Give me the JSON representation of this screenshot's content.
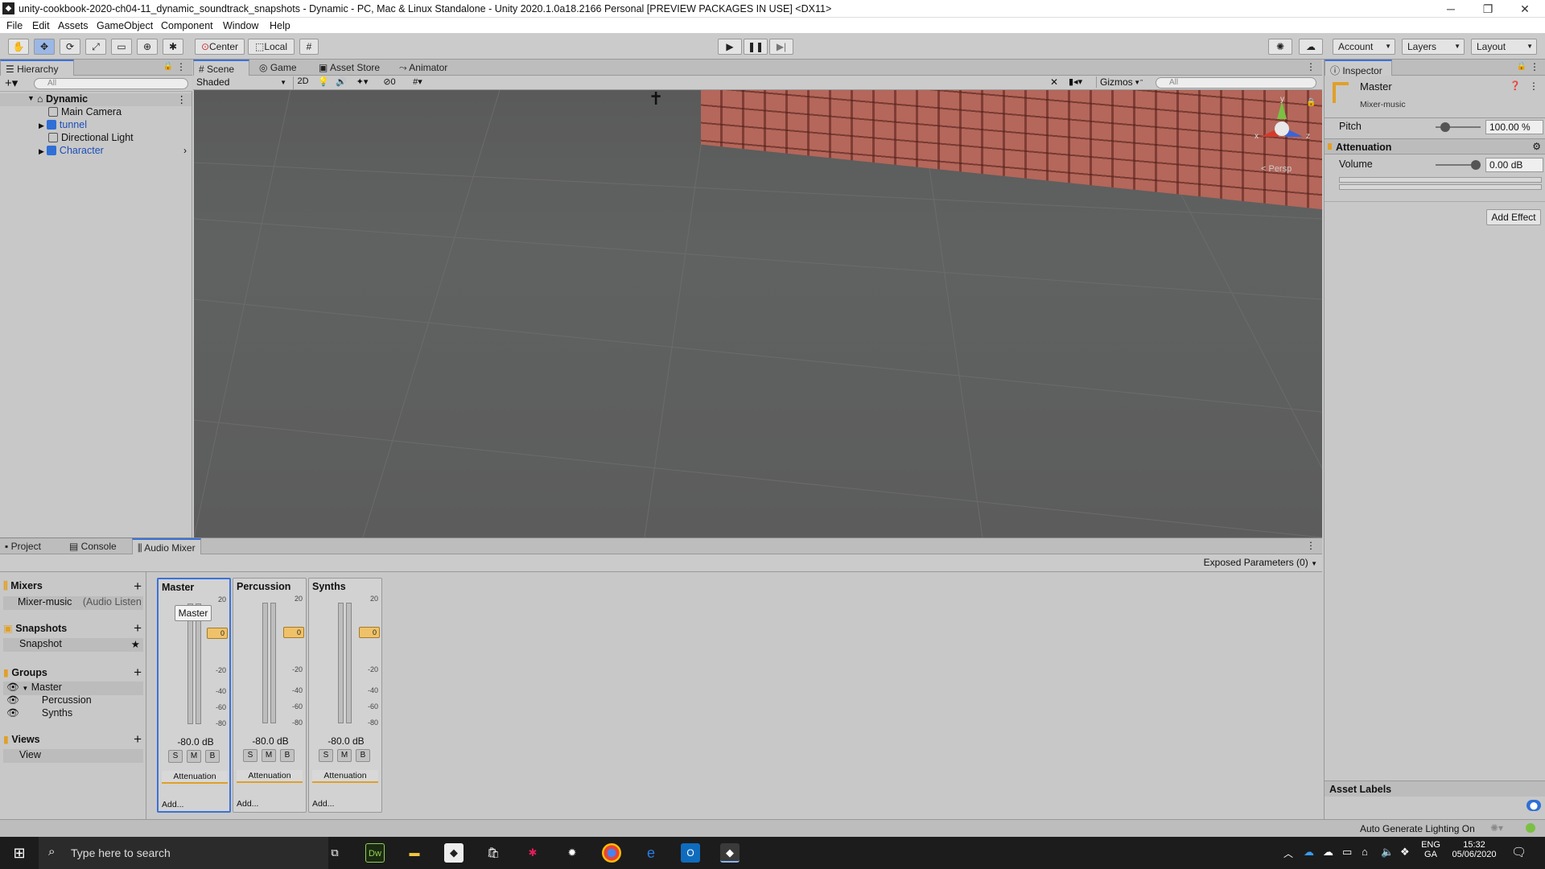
{
  "window": {
    "title": "unity-cookbook-2020-ch04-11_dynamic_soundtrack_snapshots - Dynamic - PC, Mac & Linux Standalone - Unity 2020.1.0a18.2166 Personal [PREVIEW PACKAGES IN USE] <DX11>",
    "app_icon": "unity-icon",
    "controls": [
      "─",
      "❐",
      "✕"
    ]
  },
  "menu": [
    "File",
    "Edit",
    "Assets",
    "GameObject",
    "Component",
    "Window",
    "Help"
  ],
  "toolbar": {
    "pivot": "Center",
    "space": "Local",
    "account": "Account",
    "layers": "Layers",
    "layout": "Layout"
  },
  "hierarchy": {
    "tab": "Hierarchy",
    "search_placeholder": "All",
    "scene": "Dynamic",
    "items": [
      {
        "label": "Main Camera"
      },
      {
        "label": "tunnel"
      },
      {
        "label": "Directional Light"
      },
      {
        "label": "Character"
      }
    ]
  },
  "scene_tabs": [
    "Scene",
    "Game",
    "Asset Store",
    "Animator"
  ],
  "scene_toolbar": {
    "shading": "Shaded",
    "mode2d": "2D",
    "hidden_count": "0",
    "gizmos": "Gizmos",
    "search_placeholder": "All",
    "persp_label": "< Persp"
  },
  "inspector": {
    "tab": "Inspector",
    "object_name": "Master",
    "subtitle": "Mixer-music",
    "pitch_label": "Pitch",
    "pitch_value": "100.00 %",
    "section": "Attenuation",
    "volume_label": "Volume",
    "volume_value": "0.00 dB",
    "add_effect": "Add Effect",
    "asset_labels": "Asset Labels",
    "status": "Auto Generate Lighting On"
  },
  "bottom_tabs": [
    "Project",
    "Console",
    "Audio Mixer"
  ],
  "audio_mixer": {
    "exposed_params": "Exposed Parameters (0)",
    "mixers_title": "Mixers",
    "mixer_item": "Mixer-music",
    "mixer_item_suffix": "(Audio Listen",
    "snapshots_title": "Snapshots",
    "snapshot_item": "Snapshot",
    "groups_title": "Groups",
    "groups": [
      "Master",
      "Percussion",
      "Synths"
    ],
    "views_title": "Views",
    "view_item": "View",
    "scale_labels": [
      "20",
      "0",
      "-20",
      "-40",
      "-60",
      "-80"
    ],
    "fader_value": "0",
    "tooltip": "Master",
    "channels": [
      {
        "name": "Master",
        "db": "-80.0 dB",
        "effect": "Attenuation",
        "add": "Add..."
      },
      {
        "name": "Percussion",
        "db": "-80.0 dB",
        "effect": "Attenuation",
        "add": "Add..."
      },
      {
        "name": "Synths",
        "db": "-80.0 dB",
        "effect": "Attenuation",
        "add": "Add..."
      }
    ],
    "buttons": [
      "S",
      "M",
      "B"
    ]
  },
  "taskbar": {
    "search_placeholder": "Type here to search",
    "lang_top": "ENG",
    "lang_bottom": "GA",
    "time": "15:32",
    "date": "05/06/2020",
    "dw_label": "Dw"
  },
  "colors": {
    "accent": "#3a72d8",
    "scene_bg": "#5c5c5c",
    "fader": "#efc26a",
    "effect_bar": "#e0a028"
  }
}
